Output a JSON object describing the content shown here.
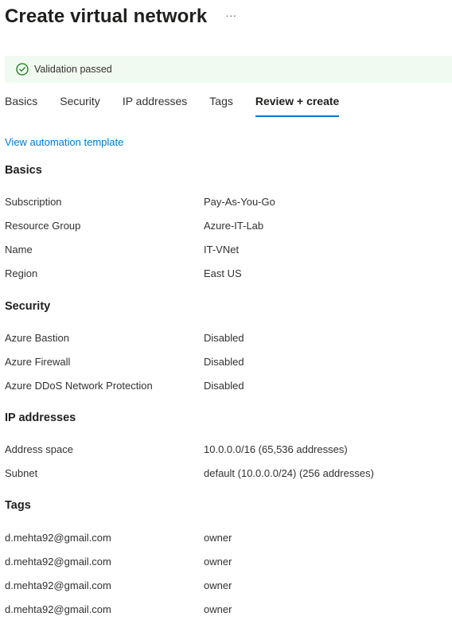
{
  "header": {
    "title": "Create virtual network",
    "more_label": "···"
  },
  "validation": {
    "message": "Validation passed",
    "icon": "check-circle-icon",
    "status_color": "#107c10"
  },
  "tabs": [
    {
      "label": "Basics",
      "active": false
    },
    {
      "label": "Security",
      "active": false
    },
    {
      "label": "IP addresses",
      "active": false
    },
    {
      "label": "Tags",
      "active": false
    },
    {
      "label": "Review + create",
      "active": true
    }
  ],
  "automation_link": "View automation template",
  "sections": {
    "basics": {
      "heading": "Basics",
      "rows": [
        {
          "label": "Subscription",
          "value": "Pay-As-You-Go"
        },
        {
          "label": "Resource Group",
          "value": "Azure-IT-Lab"
        },
        {
          "label": "Name",
          "value": "IT-VNet"
        },
        {
          "label": "Region",
          "value": "East US"
        }
      ]
    },
    "security": {
      "heading": "Security",
      "rows": [
        {
          "label": "Azure Bastion",
          "value": "Disabled"
        },
        {
          "label": "Azure Firewall",
          "value": "Disabled"
        },
        {
          "label": "Azure DDoS Network Protection",
          "value": "Disabled"
        }
      ]
    },
    "ip_addresses": {
      "heading": "IP addresses",
      "rows": [
        {
          "label": "Address space",
          "value": "10.0.0.0/16 (65,536 addresses)"
        },
        {
          "label": "Subnet",
          "value": "default (10.0.0.0/24) (256 addresses)"
        }
      ]
    },
    "tags": {
      "heading": "Tags",
      "rows": [
        {
          "label": "d.mehta92@gmail.com",
          "value": "owner"
        },
        {
          "label": "d.mehta92@gmail.com",
          "value": "owner"
        },
        {
          "label": "d.mehta92@gmail.com",
          "value": "owner"
        },
        {
          "label": "d.mehta92@gmail.com",
          "value": "owner"
        }
      ]
    }
  },
  "colors": {
    "accent": "#0078d4",
    "banner_background": "#f1faf1"
  }
}
